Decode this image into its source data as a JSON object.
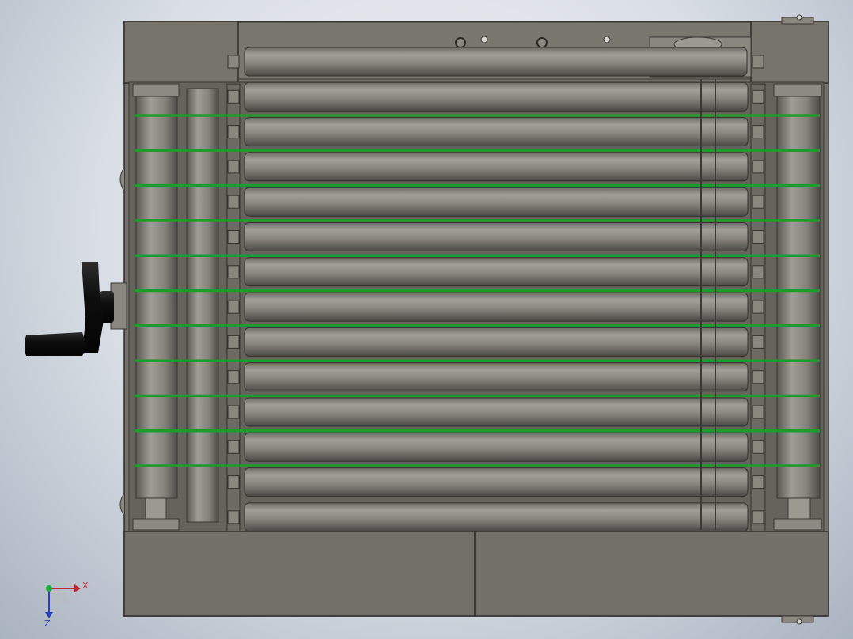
{
  "colors": {
    "frame": "#737069",
    "frame_dark": "#4a4844",
    "roller_light": "#9a9790",
    "roller_dark": "#4f4d49",
    "belt": "#1e9b2a",
    "handwheel": "#111111",
    "axis_x": "#c0282c",
    "axis_y": "#22a83a",
    "axis_z": "#2a3fbf"
  },
  "view": {
    "roller_count": 14,
    "belt_count": 11,
    "icons": [
      "handwheel-icon",
      "coordinate-triad-icon"
    ]
  },
  "triad": {
    "x_label": "X",
    "z_label": "Z"
  }
}
